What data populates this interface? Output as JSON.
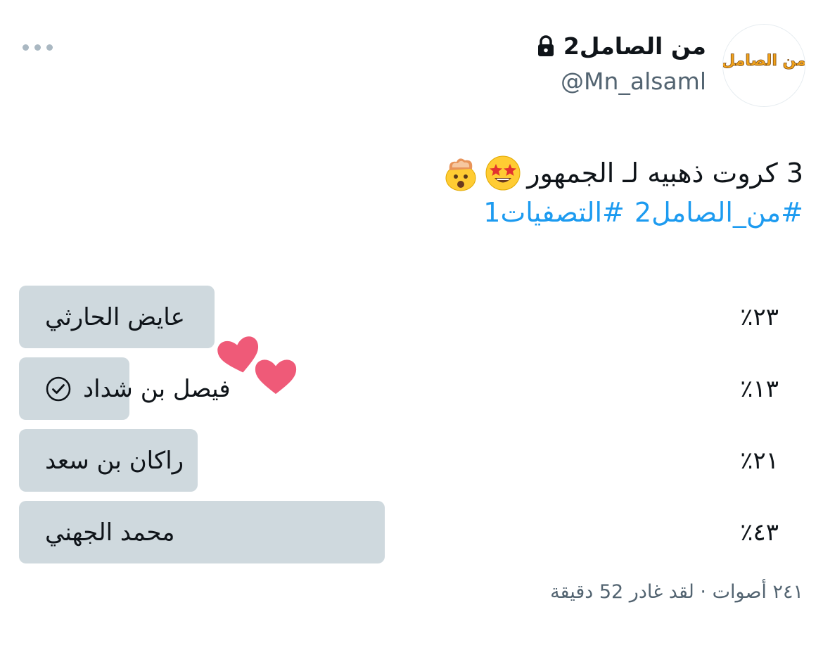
{
  "header": {
    "name": "من الصامل2",
    "handle": "@Mn_alsaml",
    "avatar_text": "من الصامل",
    "lock_icon": "lock-icon",
    "more_icon": "more-horizontal-icon"
  },
  "tweet": {
    "text": "3 كروت ذهبيه لـ الجمهور",
    "emojis": [
      "star-struck-emoji",
      "exploding-head-emoji"
    ],
    "hashtags": [
      "#من_الصامل2",
      "#التصفيات1"
    ]
  },
  "poll": {
    "options": [
      {
        "label": "عايض الحارثي",
        "percent": "٪٢٣",
        "value": 23,
        "selected": false
      },
      {
        "label": "فيصل بن شداد",
        "percent": "٪١٣",
        "value": 13,
        "selected": true
      },
      {
        "label": "راكان بن سعد",
        "percent": "٪٢١",
        "value": 21,
        "selected": false
      },
      {
        "label": "محمد الجهني",
        "percent": "٪٤٣",
        "value": 43,
        "selected": false
      }
    ],
    "meta": "٢٤١ أصوات · لقد غادر 52 دقيقة"
  },
  "colors": {
    "bar": "#cfd9de",
    "link": "#1d9bf0",
    "secondary_text": "#536471",
    "heart": "#ef5a78"
  }
}
